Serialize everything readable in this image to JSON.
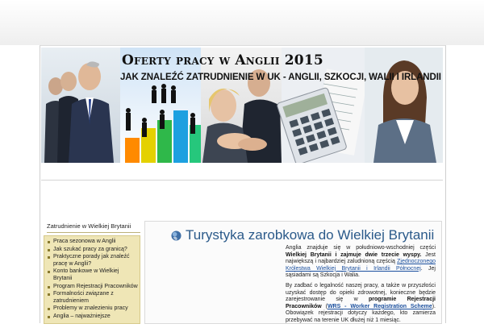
{
  "banner": {
    "title": "Oferty pracy w Anglii 2015",
    "subtitle": "JAK ZNALEŹĆ ZATRUDNIENIE W UK - ANGLII, SZKOCJI, WALII I IRLANDII"
  },
  "sidebar": {
    "heading": "Zatrudnienie w Wielkiej Brytanii",
    "items": [
      {
        "label": "Praca sezonowa w Anglii"
      },
      {
        "label": "Jak szukać pracy za granicą?"
      },
      {
        "label": "Praktyczne porady jak znaleźć pracę w Anglii?"
      },
      {
        "label": "Konto bankowe w Wielkiej Brytanii"
      },
      {
        "label": "Program Rejestracji Pracowników"
      },
      {
        "label": "Formalności związane z zatrudnieniem"
      },
      {
        "label": "Problemy w znalezieniu pracy"
      },
      {
        "label": "Anglia – najważniejsze"
      }
    ]
  },
  "content": {
    "title": "Turystyka zarobkowa do Wielkiej Brytanii",
    "p1": {
      "t1": "Anglia znajduje się w południowo-wschodniej części ",
      "b1": "Wielkiej Brytanii i zajmuje dwie trzecie wyspy.",
      "t2": " Jest największą i najbardziej zaludnioną częścią ",
      "link": "Zjednoczonego Królestwa Wielkiej Brytanii i Irlandii Północnej",
      "t3": ". Jej sąsiadami są Szkocja i Walia."
    },
    "p2": {
      "t1": "By zadbać o legalność naszej pracy, a także w przyszłości uzyskać dostęp do opieki zdrowotnej, konieczne będzie zarejestrowanie się w ",
      "b1": "programie Rejestracji Pracowników",
      "t2": " (",
      "link": "WRS - Worker Registration Scheme",
      "t3": "). Obowiązek rejestracji dotyczy każdego, kto zamierza przebywać na terenie UK dłużej niż 1 miesiąc."
    }
  },
  "colors": {
    "title_blue": "#2b5a8a",
    "link_blue": "#1a4f9e",
    "sidebar_bg": "#efe6b6"
  }
}
